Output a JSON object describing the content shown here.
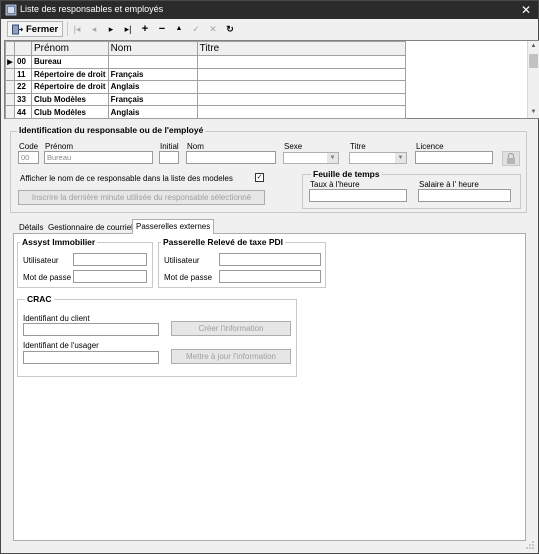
{
  "window": {
    "title": "Liste des responsables et employés",
    "close_glyph": "✕"
  },
  "toolbar": {
    "fermer_label": "Fermer",
    "buttons": [
      {
        "icon": "first-record-icon",
        "glyph": "|◂"
      },
      {
        "icon": "prev-record-icon",
        "glyph": "◂"
      },
      {
        "icon": "next-record-icon",
        "glyph": "▸"
      },
      {
        "icon": "last-record-icon",
        "glyph": "▸|"
      },
      {
        "icon": "add-icon",
        "glyph": "+"
      },
      {
        "icon": "delete-icon",
        "glyph": "−"
      },
      {
        "icon": "edit-icon",
        "glyph": "▲"
      },
      {
        "icon": "post-icon",
        "glyph": "✓"
      },
      {
        "icon": "cancel-icon",
        "glyph": "✕"
      },
      {
        "icon": "refresh-icon",
        "glyph": "↻"
      }
    ]
  },
  "grid": {
    "columns": [
      "",
      "Prénom",
      "Nom",
      "Titre"
    ],
    "rows": [
      {
        "code": "00",
        "prenom": "Bureau",
        "nom": "",
        "titre": "",
        "current": true
      },
      {
        "code": "11",
        "prenom": "Répertoire de droit",
        "nom": "Français",
        "titre": ""
      },
      {
        "code": "22",
        "prenom": "Répertoire de droit",
        "nom": "Anglais",
        "titre": ""
      },
      {
        "code": "33",
        "prenom": "Club Modèles",
        "nom": "Français",
        "titre": ""
      },
      {
        "code": "44",
        "prenom": "Club Modèles",
        "nom": "Anglais",
        "titre": ""
      }
    ]
  },
  "ident": {
    "group_title": "Identification du responsable ou de l'employé",
    "code_label": "Code",
    "code_value": "00",
    "prenom_label": "Prénom",
    "prenom_value": "Bureau",
    "initial_label": "Initial",
    "nom_label": "Nom",
    "sexe_label": "Sexe",
    "titre_label": "Titre",
    "licence_label": "Licence",
    "show_name_label": "Afficher le nom de ce responsable dans la liste des modeles",
    "show_name_checked": "✓",
    "inscrire_button": "Inscrire la dernière minute utilisée du responsable sélectionné"
  },
  "timesheet": {
    "title": "Feuille de temps",
    "taux_label": "Taux à l'heure",
    "salaire_label": "Salaire à l' heure"
  },
  "tabs": [
    {
      "label": "Détails",
      "active": false
    },
    {
      "label": "Gestionnaire de courriels",
      "active": false
    },
    {
      "label": "Passerelles externes",
      "active": true
    }
  ],
  "assyst": {
    "title": "Assyst Immobilier",
    "user_label": "Utilisateur",
    "pass_label": "Mot de passe"
  },
  "pdi": {
    "title": "Passerelle Relevé de taxe PDI",
    "user_label": "Utilisateur",
    "pass_label": "Mot de passe"
  },
  "crac": {
    "title": "CRAC",
    "client_label": "Identifiant du client",
    "user_label": "Identifiant de l'usager",
    "create_button": "Créer l'information",
    "update_button": "Mettre à jour l'information"
  },
  "colors": {
    "titlebar": "#2b2b2b",
    "window_bg": "#f0f0f0"
  }
}
